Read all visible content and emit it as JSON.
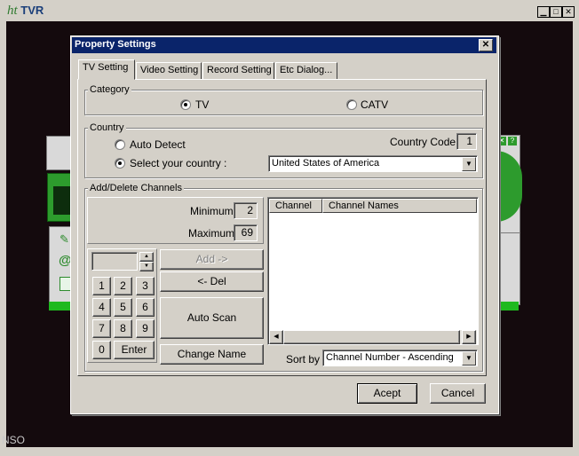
{
  "app": {
    "logo_prefix": "ht",
    "logo_text": "TVR",
    "footer_text": "NSO"
  },
  "dialog": {
    "title": "Property Settings",
    "close_label": "✕",
    "tabs": [
      "TV Setting",
      "Video Setting",
      "Record Setting",
      "Etc Dialog..."
    ],
    "category": {
      "legend": "Category",
      "options": [
        {
          "label": "TV",
          "selected": true
        },
        {
          "label": "CATV",
          "selected": false
        }
      ]
    },
    "country": {
      "legend": "Country",
      "auto_detect_label": "Auto Detect",
      "select_country_label": "Select your country :",
      "auto_detect_selected": false,
      "select_country_selected": true,
      "country_code_label": "Country Code :",
      "country_code_value": "1",
      "country_selected": "United States of America"
    },
    "channels": {
      "legend": "Add/Delete Channels",
      "minimum_label": "Minimum :",
      "minimum_value": "2",
      "maximum_label": "Maximum :",
      "maximum_value": "69",
      "keypad": [
        "1",
        "2",
        "3",
        "4",
        "5",
        "6",
        "7",
        "8",
        "9",
        "0"
      ],
      "enter_label": "Enter",
      "add_label": "Add ->",
      "del_label": "<- Del",
      "auto_scan_label": "Auto Scan",
      "change_name_label": "Change Name",
      "columns": [
        "Channel",
        "Channel Names"
      ],
      "rows": [],
      "sort_by_label": "Sort by :",
      "sort_by_value": "Channel Number - Ascending"
    },
    "accept_label": "Acept",
    "cancel_label": "Cancel"
  }
}
